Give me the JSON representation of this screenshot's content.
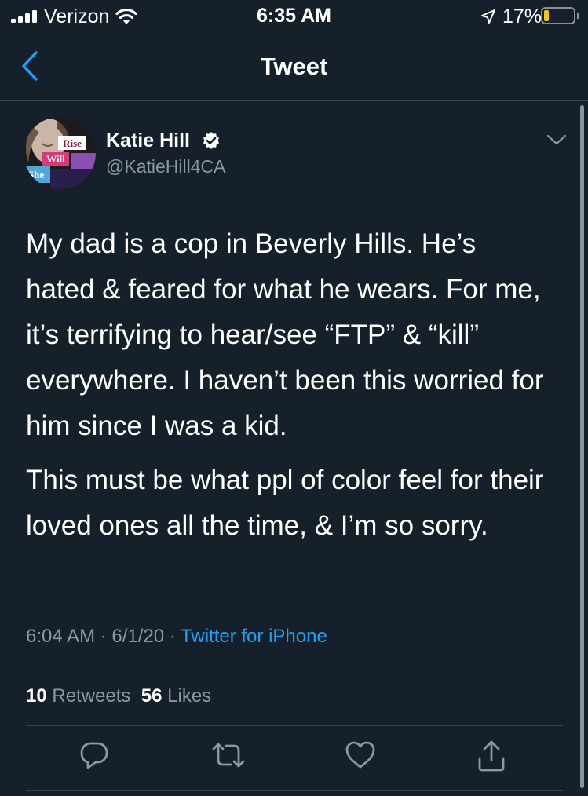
{
  "status_bar": {
    "carrier": "Verizon",
    "time": "6:35 AM",
    "battery_percent": "17%",
    "battery_level": 0.17,
    "battery_color": "#f5c518"
  },
  "nav": {
    "title": "Tweet",
    "back_icon": "chevron-left-icon"
  },
  "tweet": {
    "author_name": "Katie Hill",
    "author_handle": "@KatieHill4CA",
    "verified": true,
    "avatar_caption": [
      "Rise",
      "Will",
      "She"
    ],
    "paragraphs": [
      "My dad is a cop in Beverly Hills. He’s hated & feared for what he wears. For me, it’s terrifying to hear/see “FTP” & “kill” everywhere. I haven’t been this worried for him since I was a kid.",
      "This must be what ppl of color feel for their loved ones all the time, & I’m so sorry."
    ],
    "time": "6:04 AM",
    "separator": "·",
    "date": "6/1/20",
    "source": "Twitter for iPhone",
    "retweets_count": "10",
    "retweets_label": "Retweets",
    "likes_count": "56",
    "likes_label": "Likes"
  },
  "actions": [
    "reply-icon",
    "retweet-icon",
    "like-icon",
    "share-icon"
  ],
  "colors": {
    "background": "#15202b",
    "accent": "#1da1f2",
    "secondary_text": "#8899a6",
    "divider": "#38444d"
  }
}
